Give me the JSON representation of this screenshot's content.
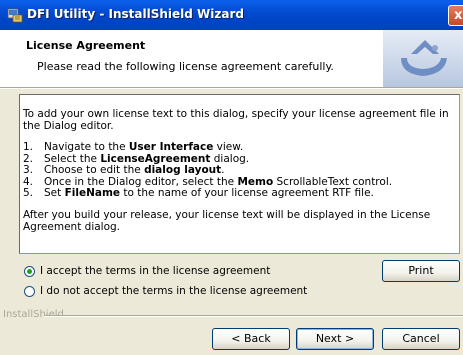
{
  "window": {
    "title": "DFI Utility - InstallShield Wizard",
    "close_label": "x"
  },
  "header": {
    "title": "License Agreement",
    "subtitle": "Please read the following license agreement carefully."
  },
  "license": {
    "intro": "To add your own license text to this dialog, specify your license agreement file in the Dialog editor.",
    "steps": [
      {
        "num": "1.",
        "pre": "Navigate to the ",
        "bold": "User Interface",
        "post": " view."
      },
      {
        "num": "2.",
        "pre": "Select the ",
        "bold": "LicenseAgreement",
        "post": " dialog."
      },
      {
        "num": "3.",
        "pre": "Choose to edit the ",
        "bold": "dialog layout",
        "post": "."
      },
      {
        "num": "4.",
        "pre": "Once in the Dialog editor, select the ",
        "bold": "Memo",
        "post": " ScrollableText control."
      },
      {
        "num": "5.",
        "pre": "Set ",
        "bold": "FileName",
        "post": " to the name of your license agreement RTF file."
      }
    ],
    "outro": "After you build your release, your license text will be displayed in the License Agreement dialog."
  },
  "options": {
    "accept_label": "I accept the terms in the license agreement",
    "decline_label": "I do not accept the terms in the license agreement",
    "selected": "accept"
  },
  "footer": {
    "brand": "InstallShield",
    "print_label": "Print",
    "back_label": "< Back",
    "next_label": "Next >",
    "cancel_label": "Cancel"
  }
}
